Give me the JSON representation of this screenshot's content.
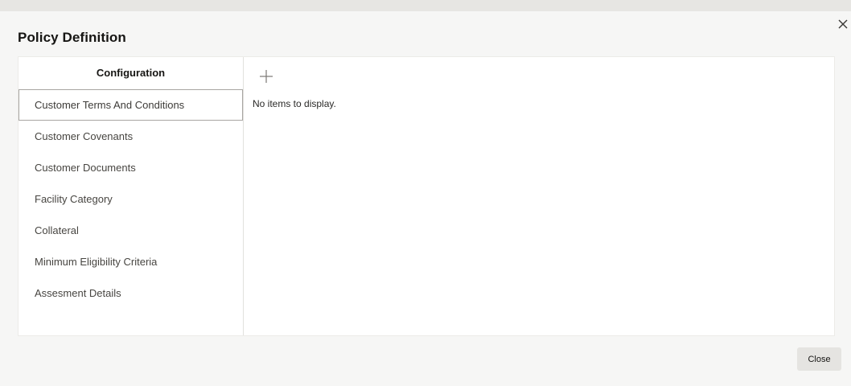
{
  "dialog": {
    "title": "Policy Definition"
  },
  "left_nav": {
    "header": "Configuration",
    "items": [
      {
        "label": "Customer Terms And Conditions",
        "selected": true
      },
      {
        "label": "Customer Covenants"
      },
      {
        "label": "Customer Documents"
      },
      {
        "label": "Facility Category"
      },
      {
        "label": "Collateral"
      },
      {
        "label": "Minimum Eligibility Criteria"
      },
      {
        "label": "Assesment Details"
      }
    ]
  },
  "content": {
    "add_icon": "plus-icon",
    "empty_message": "No items to display."
  },
  "footer": {
    "close_label": "Close"
  },
  "icons": {
    "dialog_close": "close-icon"
  },
  "colors": {
    "background": "#f6f6f5",
    "panel": "#ffffff",
    "selected_border": "#a8a6a2",
    "button": "#e5e4e1"
  }
}
